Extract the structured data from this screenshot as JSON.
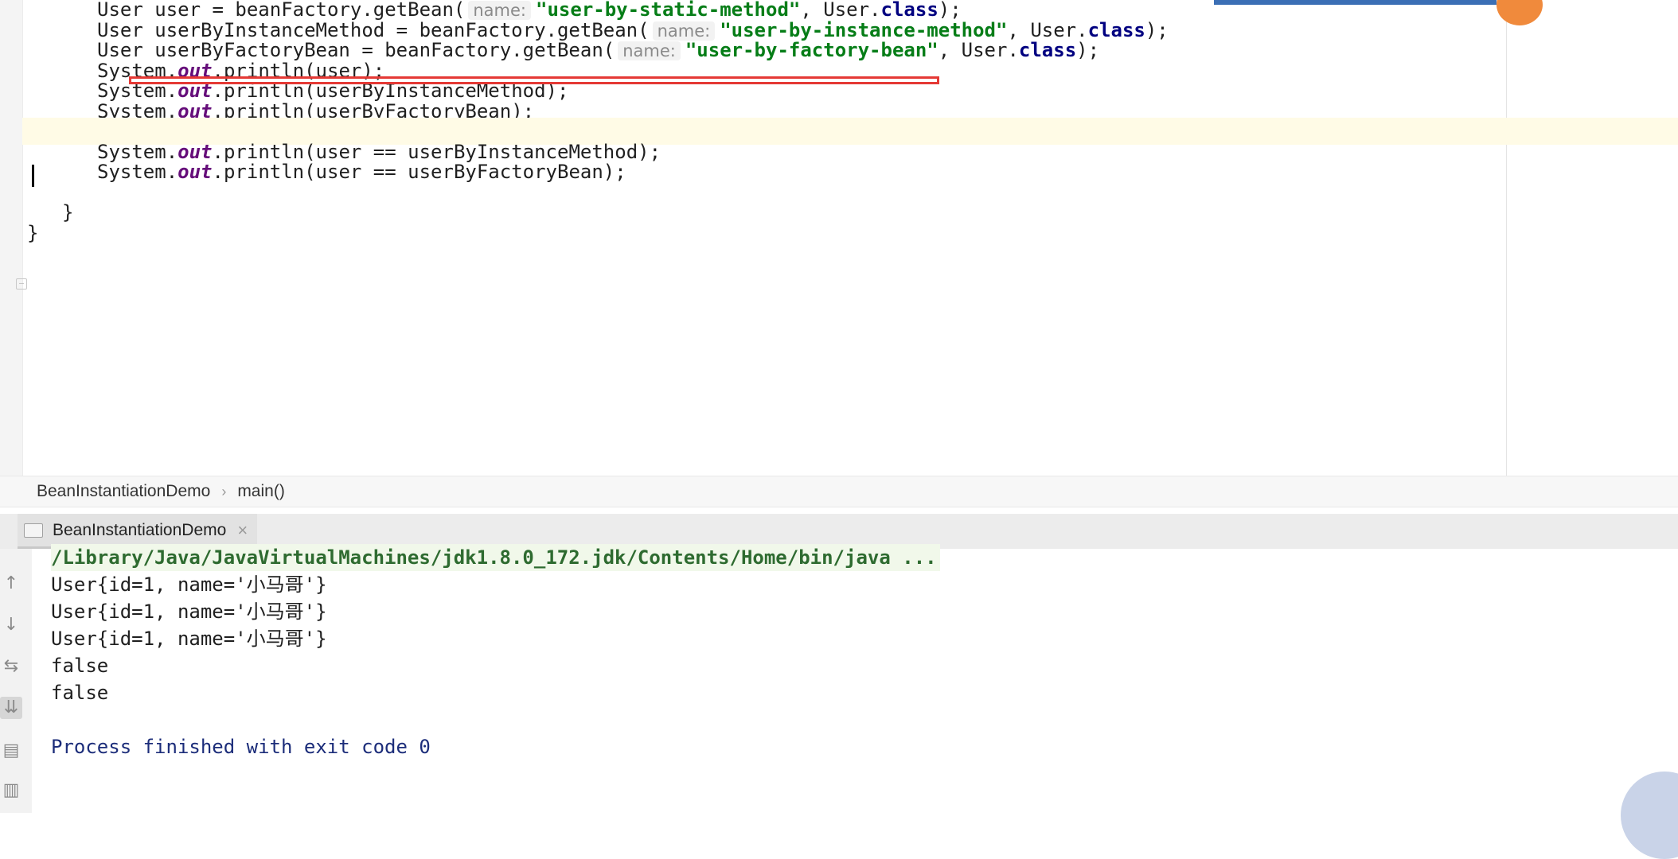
{
  "editor": {
    "lines": [
      {
        "parts": [
          [
            "t",
            "User user = beanFactory.getBean("
          ],
          [
            "h",
            "name:"
          ],
          [
            "s",
            "\"user-by-static-method\""
          ],
          [
            "t",
            ", User."
          ],
          [
            "k",
            "class"
          ],
          [
            "t",
            ");"
          ]
        ]
      },
      {
        "parts": [
          [
            "t",
            "User userByInstanceMethod = beanFactory.getBean("
          ],
          [
            "h",
            "name:"
          ],
          [
            "s",
            "\"user-by-instance-method\""
          ],
          [
            "t",
            ", User."
          ],
          [
            "k",
            "class"
          ],
          [
            "t",
            ");"
          ]
        ]
      },
      {
        "parts": [
          [
            "t",
            "User userByFactoryBean = beanFactory.getBean("
          ],
          [
            "h",
            "name:"
          ],
          [
            "s",
            "\"user-by-factory-bean\""
          ],
          [
            "t",
            ", User."
          ],
          [
            "k",
            "class"
          ],
          [
            "t",
            ");"
          ]
        ]
      },
      {
        "parts": [
          [
            "t",
            "System."
          ],
          [
            "f",
            "out"
          ],
          [
            "t",
            ".println(user);"
          ]
        ]
      },
      {
        "parts": [
          [
            "t",
            "System."
          ],
          [
            "f",
            "out"
          ],
          [
            "t",
            ".println(userByInstanceMethod);"
          ]
        ]
      },
      {
        "parts": [
          [
            "t",
            "System."
          ],
          [
            "f",
            "out"
          ],
          [
            "t",
            ".println(userByFactoryBean);"
          ]
        ]
      },
      {
        "parts": []
      },
      {
        "parts": [
          [
            "t",
            "System."
          ],
          [
            "f",
            "out"
          ],
          [
            "t",
            ".println(user == userByInstanceMethod);"
          ]
        ]
      },
      {
        "parts": [
          [
            "t",
            "System."
          ],
          [
            "f",
            "out"
          ],
          [
            "t",
            ".println(user == userByFactoryBean);"
          ]
        ]
      },
      {
        "parts": []
      },
      {
        "parts": [
          [
            "t",
            "}"
          ]
        ]
      },
      {
        "parts": [
          [
            "t",
            "}"
          ]
        ]
      }
    ],
    "indents": [
      122,
      122,
      122,
      122,
      122,
      122,
      122,
      122,
      122,
      122,
      78,
      34
    ],
    "colors": {
      "keyword": "#000080",
      "string": "#067d17",
      "field": "#660e7a",
      "hint": "#8a8a8a",
      "highlight": "#e53935"
    }
  },
  "breadcrumb": {
    "class_name": "BeanInstantiationDemo",
    "method_name": "main()"
  },
  "run_panel": {
    "tab_label": "BeanInstantiationDemo",
    "tab_close": "×",
    "console_lines": [
      "/Library/Java/JavaVirtualMachines/jdk1.8.0_172.jdk/Contents/Home/bin/java ...",
      "User{id=1, name='小马哥'}",
      "User{id=1, name='小马哥'}",
      "User{id=1, name='小马哥'}",
      "false",
      "false",
      "",
      "Process finished with exit code 0"
    ],
    "toolbar_icons": [
      "arrow-up-icon",
      "arrow-down-icon",
      "soft-wrap-icon",
      "scroll-to-end-icon",
      "print-icon",
      "trash-icon"
    ]
  }
}
